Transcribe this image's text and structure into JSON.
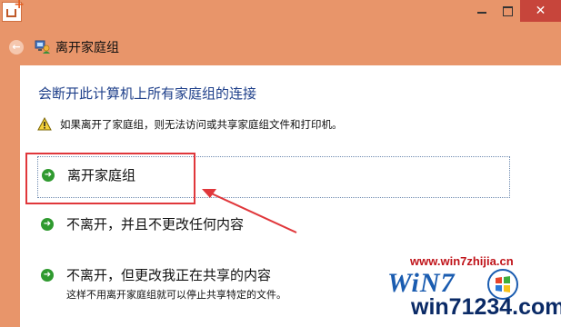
{
  "window": {
    "minimize_symbol": "—",
    "close_symbol": "✕"
  },
  "nav": {
    "back_symbol": "←",
    "title": "离开家庭组"
  },
  "main": {
    "heading": "会断开此计算机上所有家庭组的连接",
    "warning": "如果离开了家庭组，则无法访问或共享家庭组文件和打印机。",
    "options": [
      {
        "label": "离开家庭组",
        "sublabel": ""
      },
      {
        "label": "不离开，并且不更改任何内容",
        "sublabel": ""
      },
      {
        "label": "不离开，但更改我正在共享的内容",
        "sublabel": "这样不用离开家庭组就可以停止共享特定的文件。"
      }
    ]
  },
  "watermark": {
    "site": "www.win7zhijia.cn",
    "logo": "WiN7",
    "number": "win71234.com"
  },
  "colors": {
    "frame": "#e8956a",
    "close_button": "#c7453b",
    "heading": "#1e3f8a",
    "arrow_icon": "#2f9a2f",
    "annotation": "#e0373b"
  },
  "icons": [
    "app-icon",
    "minimize-icon",
    "maximize-icon",
    "close-icon",
    "back-arrow-icon",
    "homegroup-icon",
    "warning-icon",
    "green-arrow-icon"
  ]
}
